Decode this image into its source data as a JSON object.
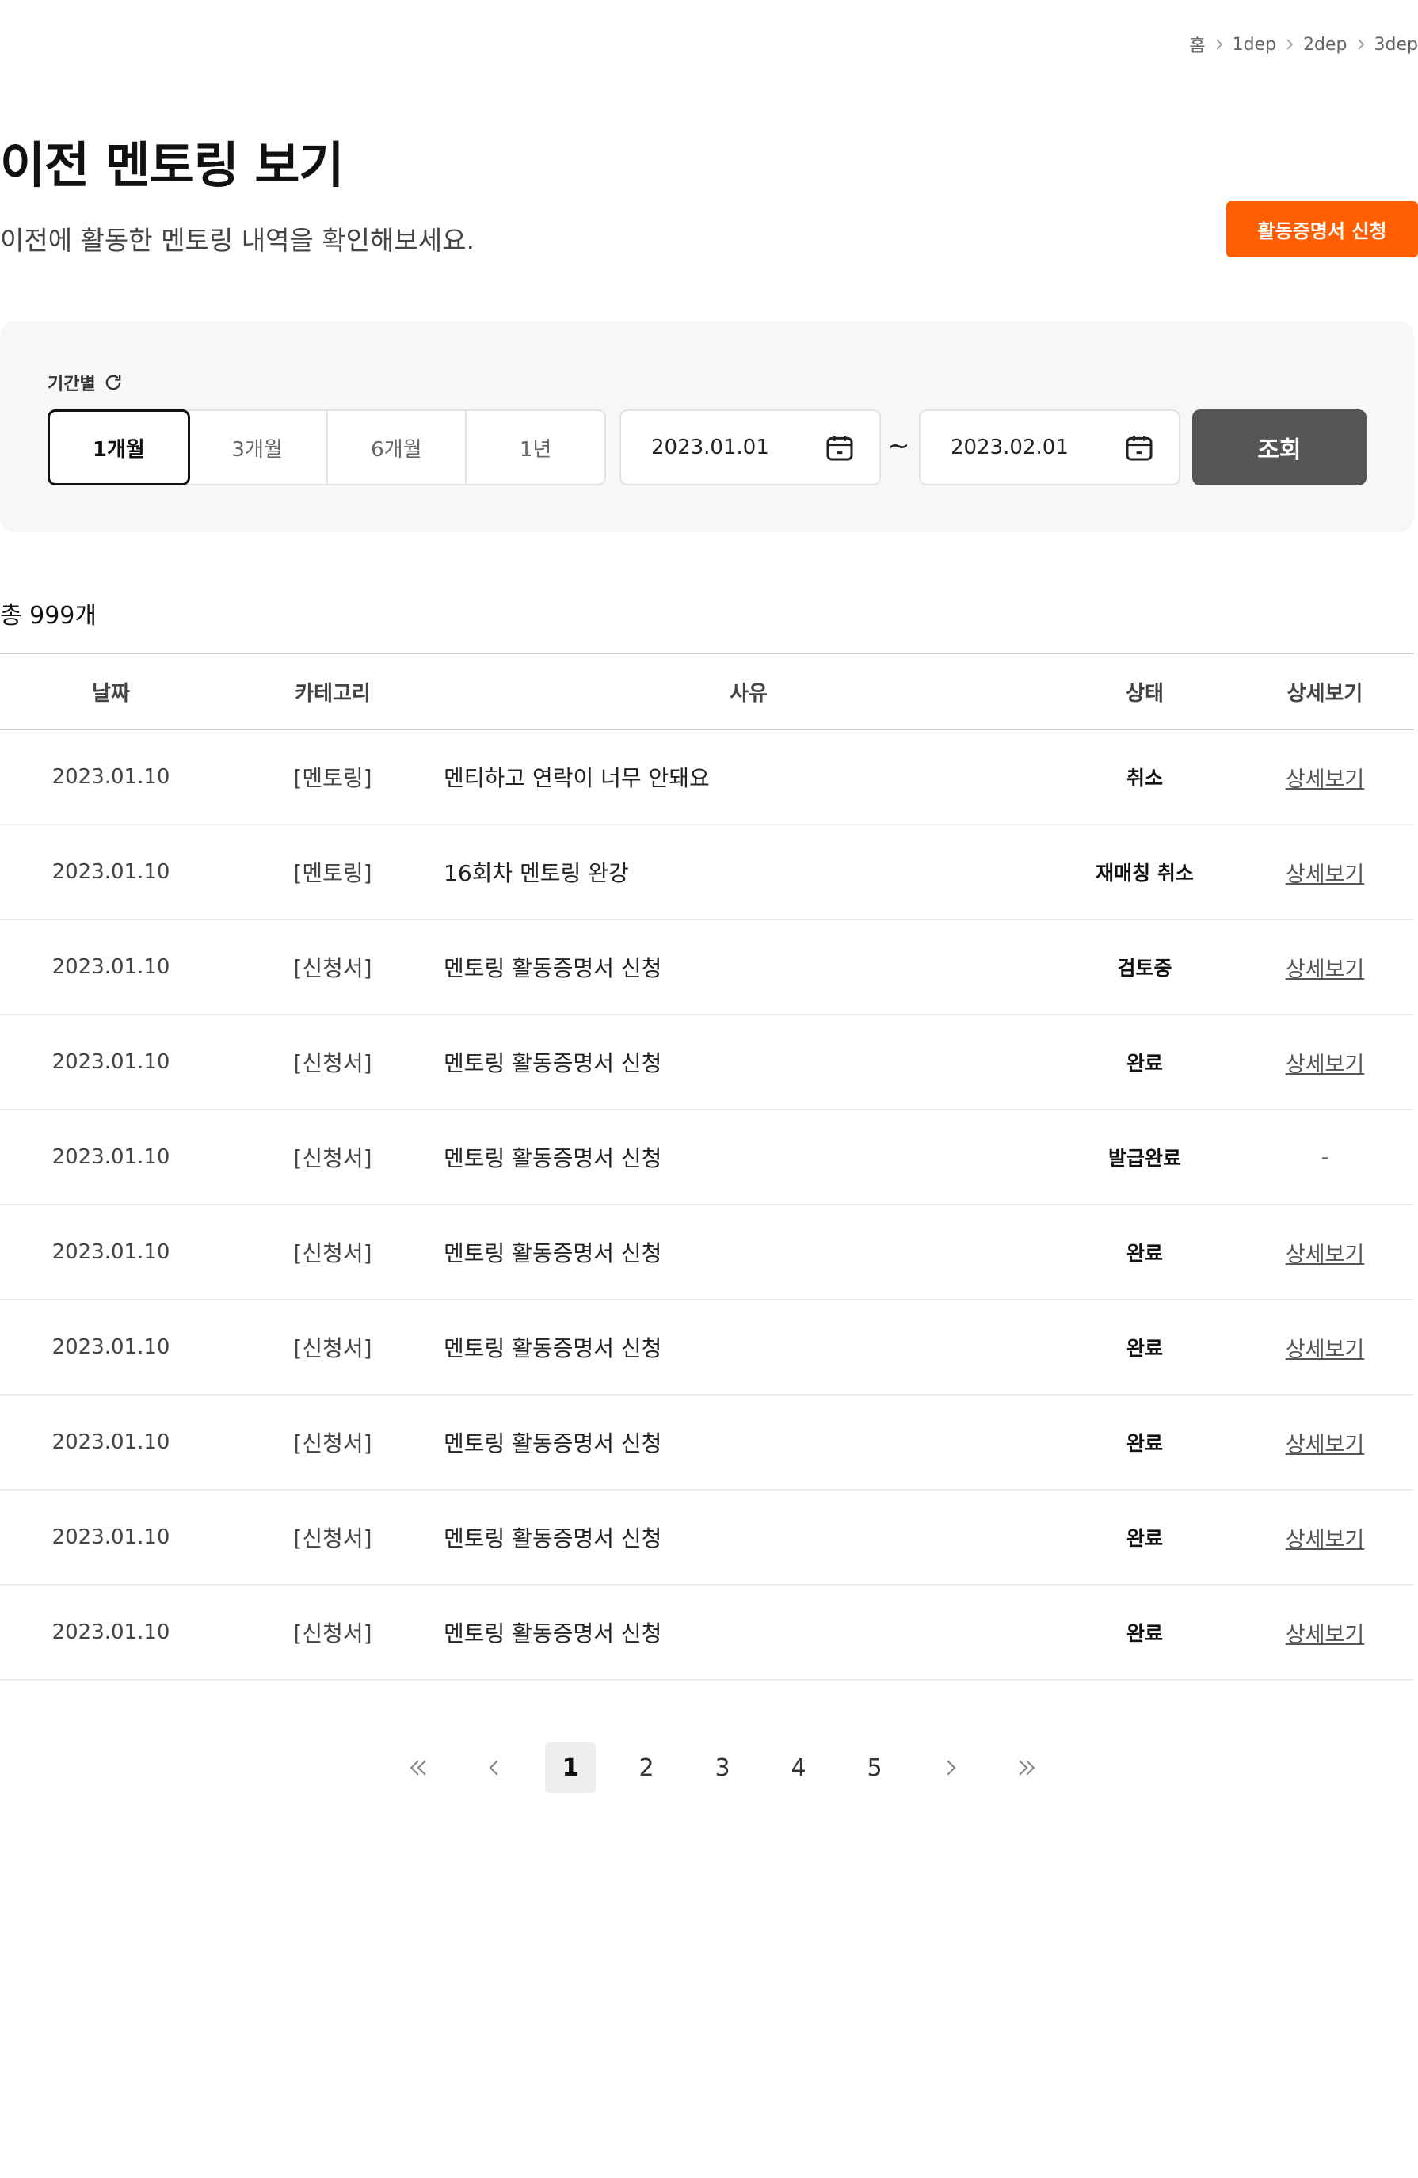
{
  "breadcrumb": {
    "items": [
      "홈",
      "1dep",
      "2dep",
      "3dep"
    ]
  },
  "page": {
    "title": "이전 멘토링 보기",
    "description": "이전에 활동한 멘토링 내역을 확인해보세요.",
    "apply_button": "활동증명서 신청"
  },
  "filter": {
    "label": "기간별",
    "periods": [
      "1개월",
      "3개월",
      "6개월",
      "1년"
    ],
    "active_period": "1개월",
    "start_date": "2023.01.01",
    "end_date": "2023.02.01",
    "tilde": "~",
    "search_button": "조회"
  },
  "total": "총 999개",
  "table": {
    "headers": {
      "date": "날짜",
      "category": "카테고리",
      "reason": "사유",
      "status": "상태",
      "detail": "상세보기"
    },
    "rows": [
      {
        "date": "2023.01.10",
        "category": "[멘토링]",
        "reason": "멘티하고 연락이 너무 안돼요",
        "status": "취소",
        "detail": "상세보기"
      },
      {
        "date": "2023.01.10",
        "category": "[멘토링]",
        "reason": "16회차 멘토링 완강",
        "status": "재매칭 취소",
        "detail": "상세보기"
      },
      {
        "date": "2023.01.10",
        "category": "[신청서]",
        "reason": "멘토링 활동증명서 신청",
        "status": "검토중",
        "detail": "상세보기"
      },
      {
        "date": "2023.01.10",
        "category": "[신청서]",
        "reason": "멘토링 활동증명서 신청",
        "status": "완료",
        "detail": "상세보기"
      },
      {
        "date": "2023.01.10",
        "category": "[신청서]",
        "reason": "멘토링 활동증명서 신청",
        "status": "발급완료",
        "detail": "-"
      },
      {
        "date": "2023.01.10",
        "category": "[신청서]",
        "reason": "멘토링 활동증명서 신청",
        "status": "완료",
        "detail": "상세보기"
      },
      {
        "date": "2023.01.10",
        "category": "[신청서]",
        "reason": "멘토링 활동증명서 신청",
        "status": "완료",
        "detail": "상세보기"
      },
      {
        "date": "2023.01.10",
        "category": "[신청서]",
        "reason": "멘토링 활동증명서 신청",
        "status": "완료",
        "detail": "상세보기"
      },
      {
        "date": "2023.01.10",
        "category": "[신청서]",
        "reason": "멘토링 활동증명서 신청",
        "status": "완료",
        "detail": "상세보기"
      },
      {
        "date": "2023.01.10",
        "category": "[신청서]",
        "reason": "멘토링 활동증명서 신청",
        "status": "완료",
        "detail": "상세보기"
      }
    ]
  },
  "pagination": {
    "pages": [
      "1",
      "2",
      "3",
      "4",
      "5"
    ],
    "current": "1"
  },
  "colors": {
    "accent": "#ff5f00",
    "search_button": "#555555",
    "filter_bg": "#f7f7f7"
  },
  "icons": {
    "refresh": "refresh-icon",
    "calendar": "calendar-icon",
    "breadcrumb_sep": "chevron-right-icon"
  }
}
